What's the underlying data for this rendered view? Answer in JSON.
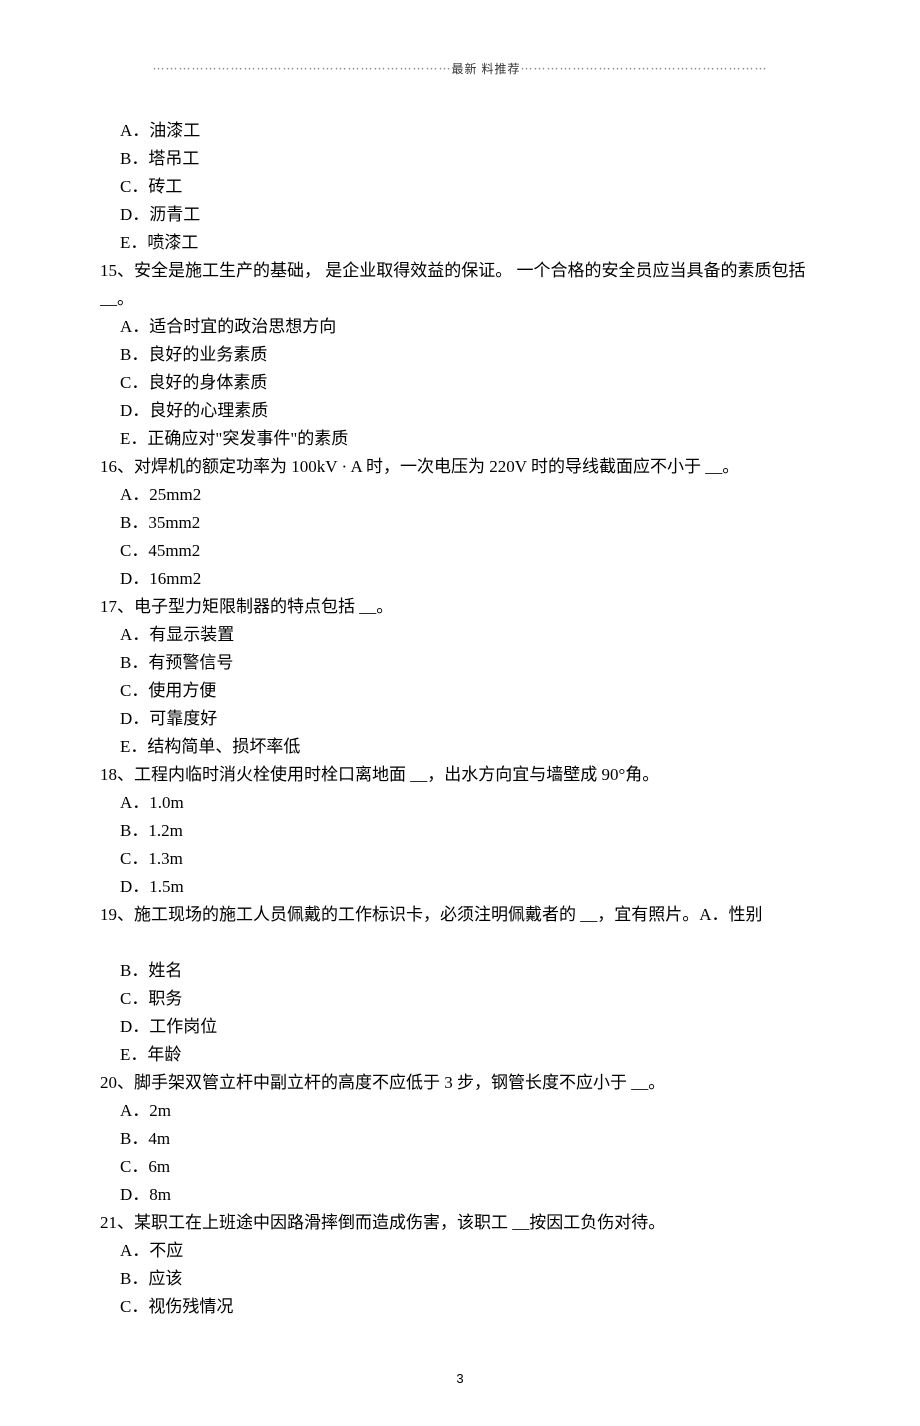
{
  "header": {
    "dots_left": "⋯⋯⋯⋯⋯⋯⋯⋯⋯⋯⋯⋯⋯⋯⋯⋯⋯⋯⋯⋯⋯⋯⋯",
    "text": "最新 料推荐",
    "dots_right": "⋯⋯⋯⋯⋯⋯⋯⋯⋯⋯⋯⋯⋯⋯⋯⋯⋯⋯⋯"
  },
  "q14_options": {
    "A": "A．油漆工",
    "B": "B．塔吊工",
    "C": "C．砖工",
    "D": "D．沥青工",
    "E": "E．喷漆工"
  },
  "q15": {
    "stem": "15、安全是施工生产的基础，  是企业取得效益的保证。 一个合格的安全员应当具备的素质包括 __。",
    "A": "A．适合时宜的政治思想方向",
    "B": "B．良好的业务素质",
    "C": "C．良好的身体素质",
    "D": "D．良好的心理素质",
    "E": "E．正确应对\"突发事件\"的素质"
  },
  "q16": {
    "stem": "16、对焊机的额定功率为   100kV · A 时，一次电压为  220V 时的导线截面应不小于 __。",
    "A": "A．25mm2",
    "B": "B．35mm2",
    "C": "C．45mm2",
    "D": "D．16mm2"
  },
  "q17": {
    "stem": "17、电子型力矩限制器的特点包括   __。",
    "A": "A．有显示装置",
    "B": "B．有预警信号",
    "C": "C．使用方便",
    "D": "D．可靠度好",
    "E": "E．结构简单、损坏率低"
  },
  "q18": {
    "stem": "18、工程内临时消火栓使用时栓口离地面    __，出水方向宜与墙壁成   90°角。",
    "A": "A．1.0m",
    "B": "B．1.2m",
    "C": "C．1.3m",
    "D": "D．1.5m"
  },
  "q19": {
    "stem": "19、施工现场的施工人员佩戴的工作标识卡，必须注明佩戴者的 __，宜有照片。A．性别",
    "B": "B．姓名",
    "C": "C．职务",
    "D": "D．工作岗位",
    "E": "E．年龄"
  },
  "q20": {
    "stem": "20、脚手架双管立杆中副立杆的高度不应低于     3 步，钢管长度不应小于  __。",
    "A": "A．2m",
    "B": "B．4m",
    "C": "C．6m",
    "D": "D．8m"
  },
  "q21": {
    "stem": "21、某职工在上班途中因路滑摔倒而造成伤害，该职工     __按因工负伤对待。",
    "A": "A．不应",
    "B": "B．应该",
    "C": "C．视伤残情况"
  },
  "page_number": "3"
}
